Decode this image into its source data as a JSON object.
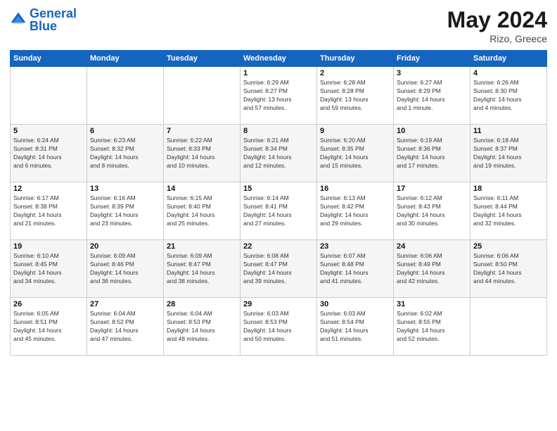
{
  "header": {
    "logo_general": "General",
    "logo_blue": "Blue",
    "month_title": "May 2024",
    "location": "Rizo, Greece"
  },
  "days_of_week": [
    "Sunday",
    "Monday",
    "Tuesday",
    "Wednesday",
    "Thursday",
    "Friday",
    "Saturday"
  ],
  "weeks": [
    [
      {
        "day": "",
        "info": ""
      },
      {
        "day": "",
        "info": ""
      },
      {
        "day": "",
        "info": ""
      },
      {
        "day": "1",
        "info": "Sunrise: 6:29 AM\nSunset: 8:27 PM\nDaylight: 13 hours\nand 57 minutes."
      },
      {
        "day": "2",
        "info": "Sunrise: 6:28 AM\nSunset: 8:28 PM\nDaylight: 13 hours\nand 59 minutes."
      },
      {
        "day": "3",
        "info": "Sunrise: 6:27 AM\nSunset: 8:29 PM\nDaylight: 14 hours\nand 1 minute."
      },
      {
        "day": "4",
        "info": "Sunrise: 6:26 AM\nSunset: 8:30 PM\nDaylight: 14 hours\nand 4 minutes."
      }
    ],
    [
      {
        "day": "5",
        "info": "Sunrise: 6:24 AM\nSunset: 8:31 PM\nDaylight: 14 hours\nand 6 minutes."
      },
      {
        "day": "6",
        "info": "Sunrise: 6:23 AM\nSunset: 8:32 PM\nDaylight: 14 hours\nand 8 minutes."
      },
      {
        "day": "7",
        "info": "Sunrise: 6:22 AM\nSunset: 8:33 PM\nDaylight: 14 hours\nand 10 minutes."
      },
      {
        "day": "8",
        "info": "Sunrise: 6:21 AM\nSunset: 8:34 PM\nDaylight: 14 hours\nand 12 minutes."
      },
      {
        "day": "9",
        "info": "Sunrise: 6:20 AM\nSunset: 8:35 PM\nDaylight: 14 hours\nand 15 minutes."
      },
      {
        "day": "10",
        "info": "Sunrise: 6:19 AM\nSunset: 8:36 PM\nDaylight: 14 hours\nand 17 minutes."
      },
      {
        "day": "11",
        "info": "Sunrise: 6:18 AM\nSunset: 8:37 PM\nDaylight: 14 hours\nand 19 minutes."
      }
    ],
    [
      {
        "day": "12",
        "info": "Sunrise: 6:17 AM\nSunset: 8:38 PM\nDaylight: 14 hours\nand 21 minutes."
      },
      {
        "day": "13",
        "info": "Sunrise: 6:16 AM\nSunset: 8:39 PM\nDaylight: 14 hours\nand 23 minutes."
      },
      {
        "day": "14",
        "info": "Sunrise: 6:15 AM\nSunset: 8:40 PM\nDaylight: 14 hours\nand 25 minutes."
      },
      {
        "day": "15",
        "info": "Sunrise: 6:14 AM\nSunset: 8:41 PM\nDaylight: 14 hours\nand 27 minutes."
      },
      {
        "day": "16",
        "info": "Sunrise: 6:13 AM\nSunset: 8:42 PM\nDaylight: 14 hours\nand 29 minutes."
      },
      {
        "day": "17",
        "info": "Sunrise: 6:12 AM\nSunset: 8:43 PM\nDaylight: 14 hours\nand 30 minutes."
      },
      {
        "day": "18",
        "info": "Sunrise: 6:11 AM\nSunset: 8:44 PM\nDaylight: 14 hours\nand 32 minutes."
      }
    ],
    [
      {
        "day": "19",
        "info": "Sunrise: 6:10 AM\nSunset: 8:45 PM\nDaylight: 14 hours\nand 34 minutes."
      },
      {
        "day": "20",
        "info": "Sunrise: 6:09 AM\nSunset: 8:46 PM\nDaylight: 14 hours\nand 36 minutes."
      },
      {
        "day": "21",
        "info": "Sunrise: 6:09 AM\nSunset: 8:47 PM\nDaylight: 14 hours\nand 38 minutes."
      },
      {
        "day": "22",
        "info": "Sunrise: 6:08 AM\nSunset: 8:47 PM\nDaylight: 14 hours\nand 39 minutes."
      },
      {
        "day": "23",
        "info": "Sunrise: 6:07 AM\nSunset: 8:48 PM\nDaylight: 14 hours\nand 41 minutes."
      },
      {
        "day": "24",
        "info": "Sunrise: 6:06 AM\nSunset: 8:49 PM\nDaylight: 14 hours\nand 42 minutes."
      },
      {
        "day": "25",
        "info": "Sunrise: 6:06 AM\nSunset: 8:50 PM\nDaylight: 14 hours\nand 44 minutes."
      }
    ],
    [
      {
        "day": "26",
        "info": "Sunrise: 6:05 AM\nSunset: 8:51 PM\nDaylight: 14 hours\nand 45 minutes."
      },
      {
        "day": "27",
        "info": "Sunrise: 6:04 AM\nSunset: 8:52 PM\nDaylight: 14 hours\nand 47 minutes."
      },
      {
        "day": "28",
        "info": "Sunrise: 6:04 AM\nSunset: 8:53 PM\nDaylight: 14 hours\nand 48 minutes."
      },
      {
        "day": "29",
        "info": "Sunrise: 6:03 AM\nSunset: 8:53 PM\nDaylight: 14 hours\nand 50 minutes."
      },
      {
        "day": "30",
        "info": "Sunrise: 6:03 AM\nSunset: 8:54 PM\nDaylight: 14 hours\nand 51 minutes."
      },
      {
        "day": "31",
        "info": "Sunrise: 6:02 AM\nSunset: 8:55 PM\nDaylight: 14 hours\nand 52 minutes."
      },
      {
        "day": "",
        "info": ""
      }
    ]
  ]
}
